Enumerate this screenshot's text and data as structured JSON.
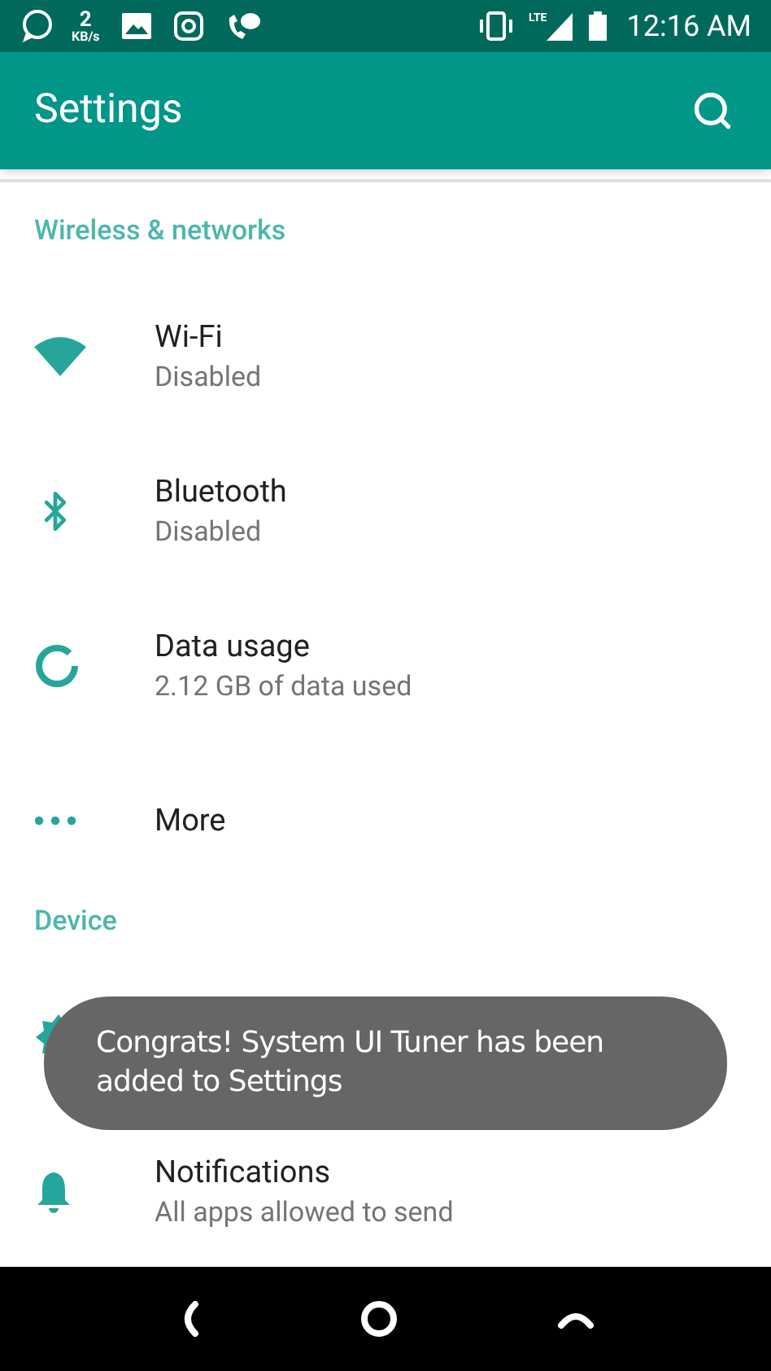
{
  "status_bar": {
    "speed_value": "2",
    "speed_unit": "KB/s",
    "time": "12:16 AM",
    "network": "LTE"
  },
  "app_bar": {
    "title": "Settings"
  },
  "sections": [
    {
      "title": "Wireless & networks",
      "items": [
        {
          "kind": "wifi",
          "title": "Wi-Fi",
          "subtitle": "Disabled"
        },
        {
          "kind": "bluetooth",
          "title": "Bluetooth",
          "subtitle": "Disabled"
        },
        {
          "kind": "data",
          "title": "Data usage",
          "subtitle": "2.12 GB of data used"
        },
        {
          "kind": "more",
          "title": "More"
        }
      ]
    },
    {
      "title": "Device",
      "items": [
        {
          "kind": "display"
        },
        {
          "kind": "notifications",
          "title": "Notifications",
          "subtitle": "All apps allowed to send"
        }
      ]
    }
  ],
  "toast": {
    "text": "Congrats! System UI Tuner has been added to Settings"
  }
}
